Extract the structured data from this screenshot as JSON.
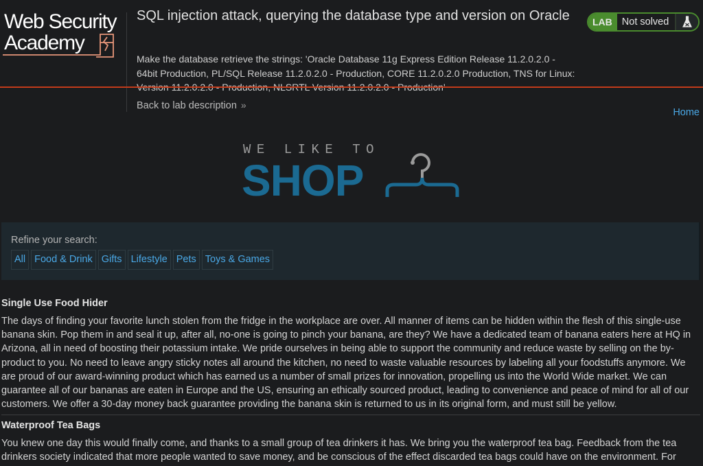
{
  "header": {
    "logo_line1": "Web Security",
    "logo_line2": "Academy",
    "title": "SQL injection attack, querying the database type and version on Oracle",
    "description": "Make the database retrieve the strings: 'Oracle Database 11g Express Edition Release 11.2.0.2.0 - 64bit Production, PL/SQL Release 11.2.0.2.0 - Production, CORE 11.2.0.2.0 Production, TNS for Linux: Version 11.2.0.2.0 - Production, NLSRTL Version 11.2.0.2.0 - Production'",
    "back_link": "Back to lab description",
    "back_icon": "double-chevron-right-icon",
    "lab_badge": {
      "label": "LAB",
      "status": "Not solved",
      "icon": "flask-icon"
    },
    "home_link": "Home",
    "accent_green": "#4a8c2e",
    "accent_red": "#c33b1a"
  },
  "shop_logo": {
    "top_text": "WE LIKE TO",
    "main_text": "SHOP",
    "icon": "hanger-icon",
    "color": "#1b6a92"
  },
  "filter": {
    "label": "Refine your search:",
    "categories": [
      "All",
      "Food & Drink",
      "Gifts",
      "Lifestyle",
      "Pets",
      "Toys & Games"
    ]
  },
  "products": [
    {
      "name": "Single Use Food Hider",
      "description": "The days of finding your favorite lunch stolen from the fridge in the workplace are over. All manner of items can be hidden within the flesh of this single-use banana skin. Pop them in and seal it up, after all, no-one is going to pinch your banana, are they? We have a dedicated team of banana eaters here at HQ in Arizona, all in need of boosting their potassium intake. We pride ourselves in being able to support the community and reduce waste by selling on the by-product to you. No need to leave angry sticky notes all around the kitchen, no need to waste valuable resources by labeling all your foodstuffs anymore. We are proud of our award-winning product which has earned us a number of small prizes for innovation, propelling us into the World Wide market. We can guarantee all of our bananas are eaten in Europe and the US, ensuring an ethically sourced product, leading to convenience and peace of mind for all of our customers. We offer a 30-day money back guarantee providing the banana skin is returned to us in its original form, and must still be yellow."
    },
    {
      "name": "Waterproof Tea Bags",
      "description": "You knew one day this would finally come, and thanks to a small group of tea drinkers it has. We bring you the waterproof tea bag. Feedback from the tea drinkers society indicated that more people wanted to save money, and be conscious of the effect discarded tea bags could have on the environment. For"
    }
  ]
}
